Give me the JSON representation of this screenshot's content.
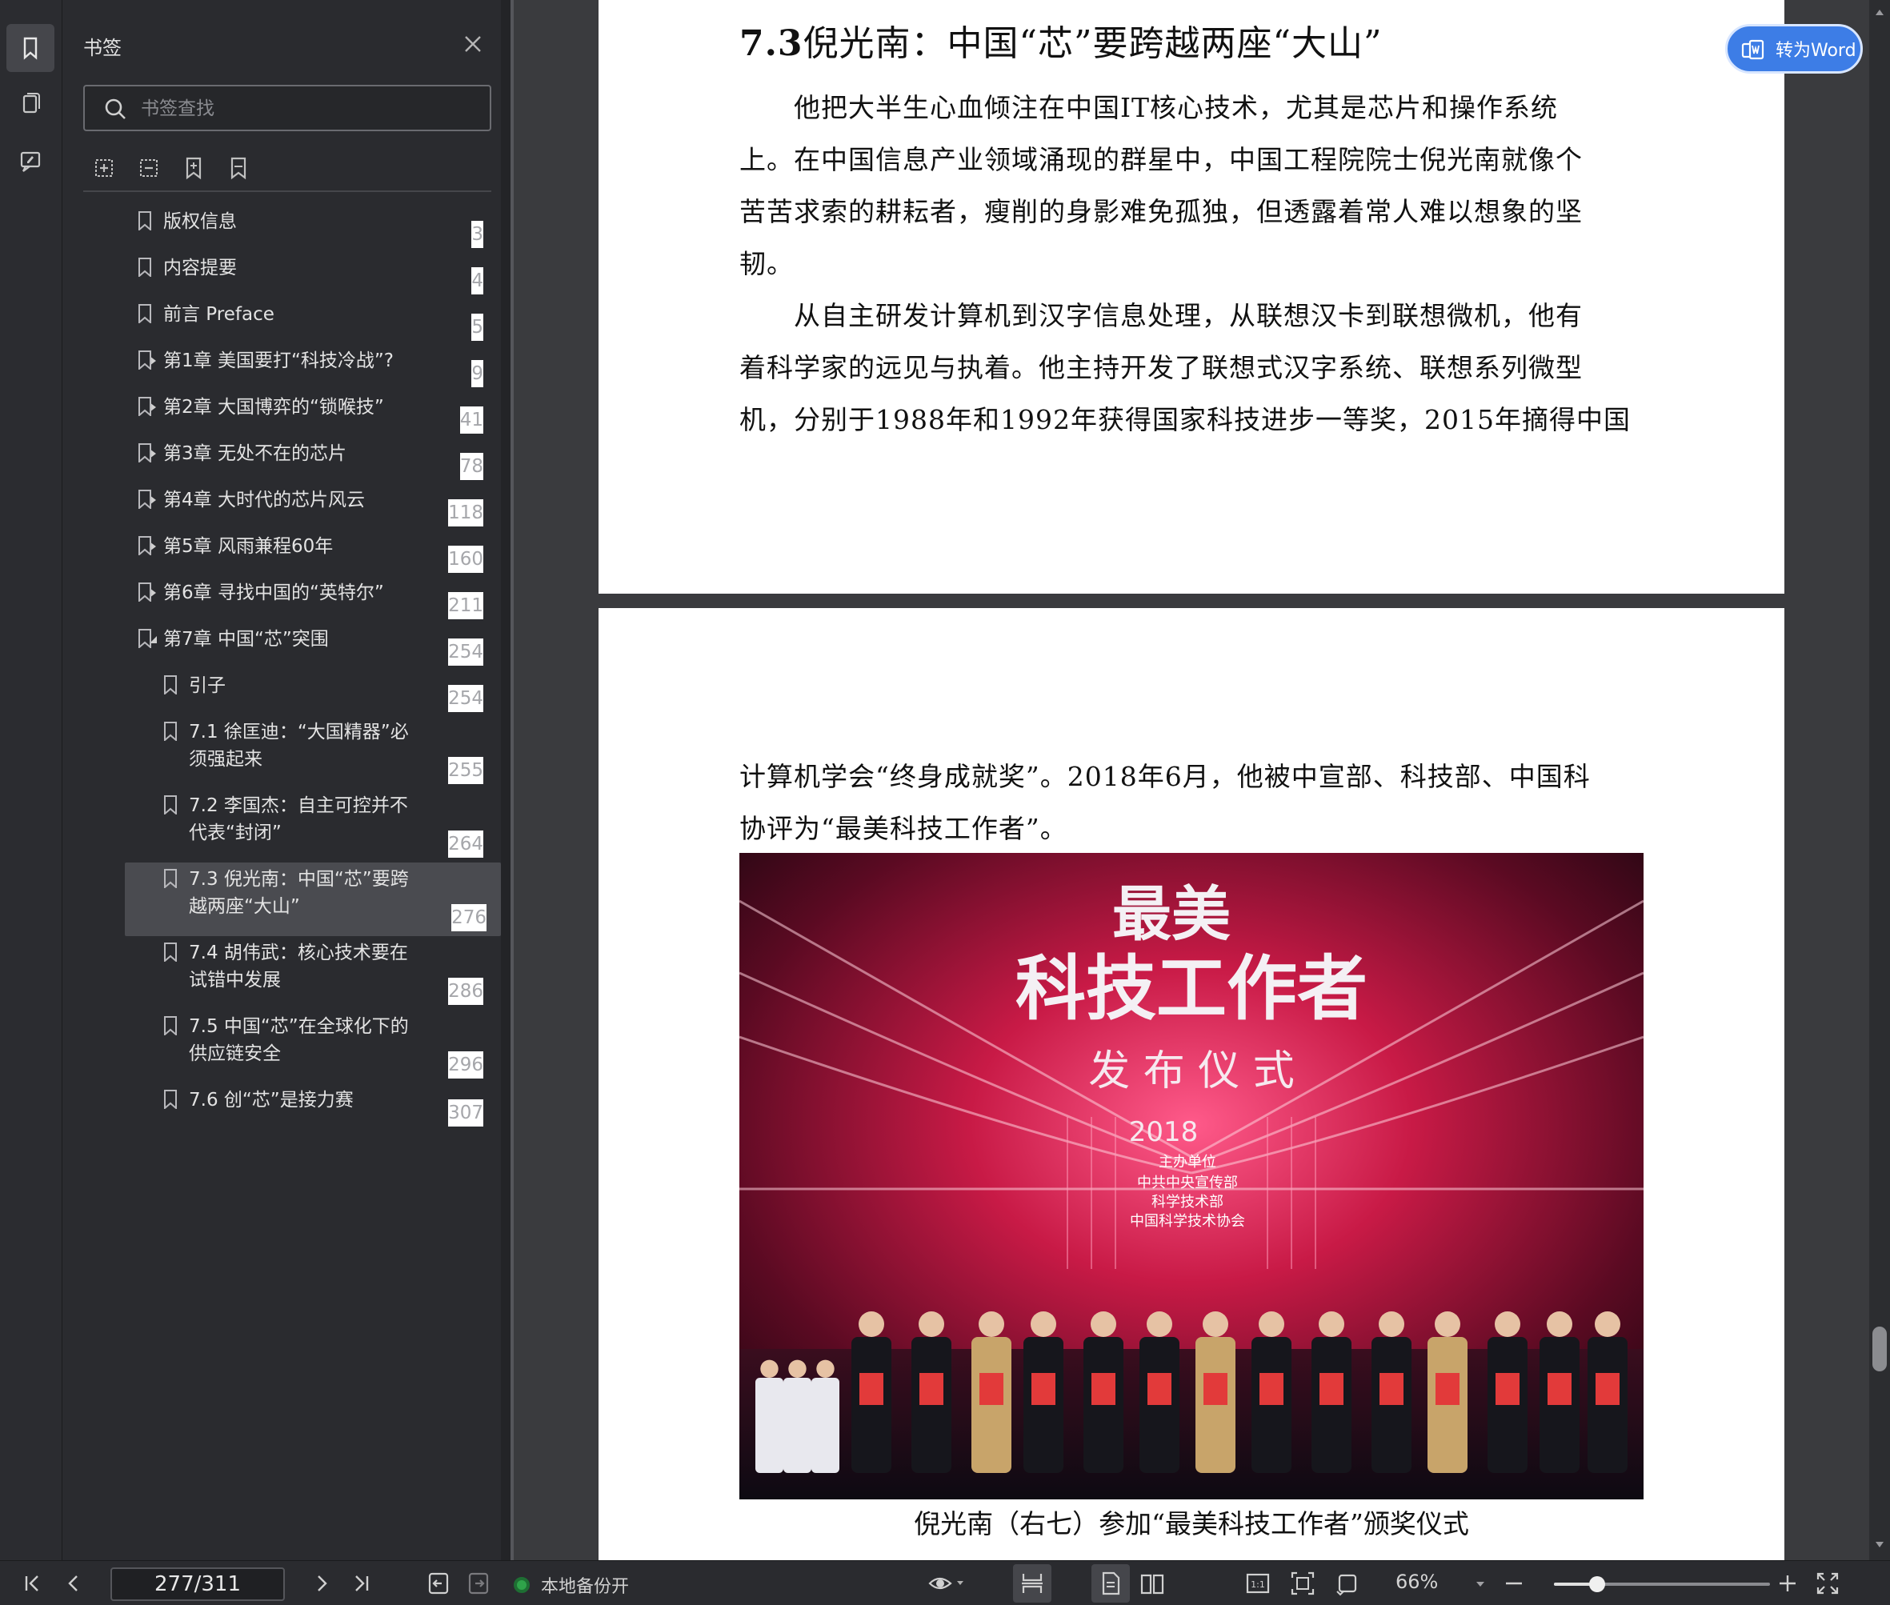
{
  "panel": {
    "title": "书签",
    "search_placeholder": "书签查找",
    "items": [
      {
        "label": "版权信息",
        "page": "3",
        "expandable": false,
        "level": 1
      },
      {
        "label": "内容提要",
        "page": "4",
        "expandable": false,
        "level": 1
      },
      {
        "label": "前言 Preface",
        "page": "5",
        "expandable": false,
        "level": 1
      },
      {
        "label": "第1章 美国要打“科技冷战”?",
        "page": "9",
        "expandable": true,
        "level": 1
      },
      {
        "label": "第2章 大国博弈的“锁喉技”",
        "page": "41",
        "expandable": true,
        "level": 1
      },
      {
        "label": "第3章 无处不在的芯片",
        "page": "78",
        "expandable": true,
        "level": 1
      },
      {
        "label": "第4章 大时代的芯片风云",
        "page": "118",
        "expandable": true,
        "level": 1
      },
      {
        "label": "第5章 风雨兼程60年",
        "page": "160",
        "expandable": true,
        "level": 1
      },
      {
        "label": "第6章 寻找中国的“英特尔”",
        "page": "211",
        "expandable": true,
        "level": 1
      },
      {
        "label": "第7章 中国“芯”突围",
        "page": "254",
        "expandable": true,
        "expanded": true,
        "level": 1
      },
      {
        "label": "引子",
        "page": "254",
        "level": 2
      },
      {
        "label": "7.1 徐匡迪：“大国精器”必\n须强起来",
        "page": "255",
        "level": 2
      },
      {
        "label": "7.2 李国杰：自主可控并不\n代表“封闭”",
        "page": "264",
        "level": 2
      },
      {
        "label": "7.3 倪光南：中国“芯”要跨\n越两座“大山”",
        "page": "276",
        "level": 2,
        "selected": true
      },
      {
        "label": "7.4 胡伟武：核心技术要在\n试错中发展",
        "page": "286",
        "level": 2
      },
      {
        "label": "7.5 中国“芯”在全球化下的\n供应链安全",
        "page": "296",
        "level": 2
      },
      {
        "label": "7.6 创“芯”是接力赛",
        "page": "307",
        "level": 2
      }
    ]
  },
  "document": {
    "heading_num": "7.3",
    "heading_text": "倪光南：中国“芯”要跨越两座“大山”",
    "page1_lines": [
      "　　他把大半生心血倾注在中国IT核心技术，尤其是芯片和操作系统",
      "上。在中国信息产业领域涌现的群星中，中国工程院院士倪光南就像个",
      "苦苦求索的耕耘者，瘦削的身影难免孤独，但透露着常人难以想象的坚",
      "韧。",
      "　　从自主研发计算机到汉字信息处理，从联想汉卡到联想微机，他有",
      "着科学家的远见与执着。他主持开发了联想式汉字系统、联想系列微型",
      "机，分别于1988年和1992年获得国家科技进步一等奖，2015年摘得中国"
    ],
    "page2_lines": [
      "计算机学会“终身成就奖”。2018年6月，他被中宣部、科技部、中国科",
      "协评为“最美科技工作者”。"
    ],
    "photo": {
      "banner_line1": "最美",
      "banner_line2": "科技工作者",
      "banner_line3": "发 布 仪 式",
      "year": "2018",
      "organizer_title": "主办单位",
      "organizers": [
        "中共中央宣传部",
        "科学技术部",
        "中国科学技术协会"
      ]
    },
    "caption": "倪光南（右七）参加“最美科技工作者”颁奖仪式"
  },
  "convert_button": "转为Word",
  "statusbar": {
    "page_indicator": "277/311",
    "backup_label": "本地备份开",
    "zoom": "66%",
    "zoom_fraction": 0.2
  },
  "colors": {
    "accent_blue": "#3d7de6",
    "backup_green": "#2fa34a",
    "panel_bg": "#2a2b2f"
  }
}
